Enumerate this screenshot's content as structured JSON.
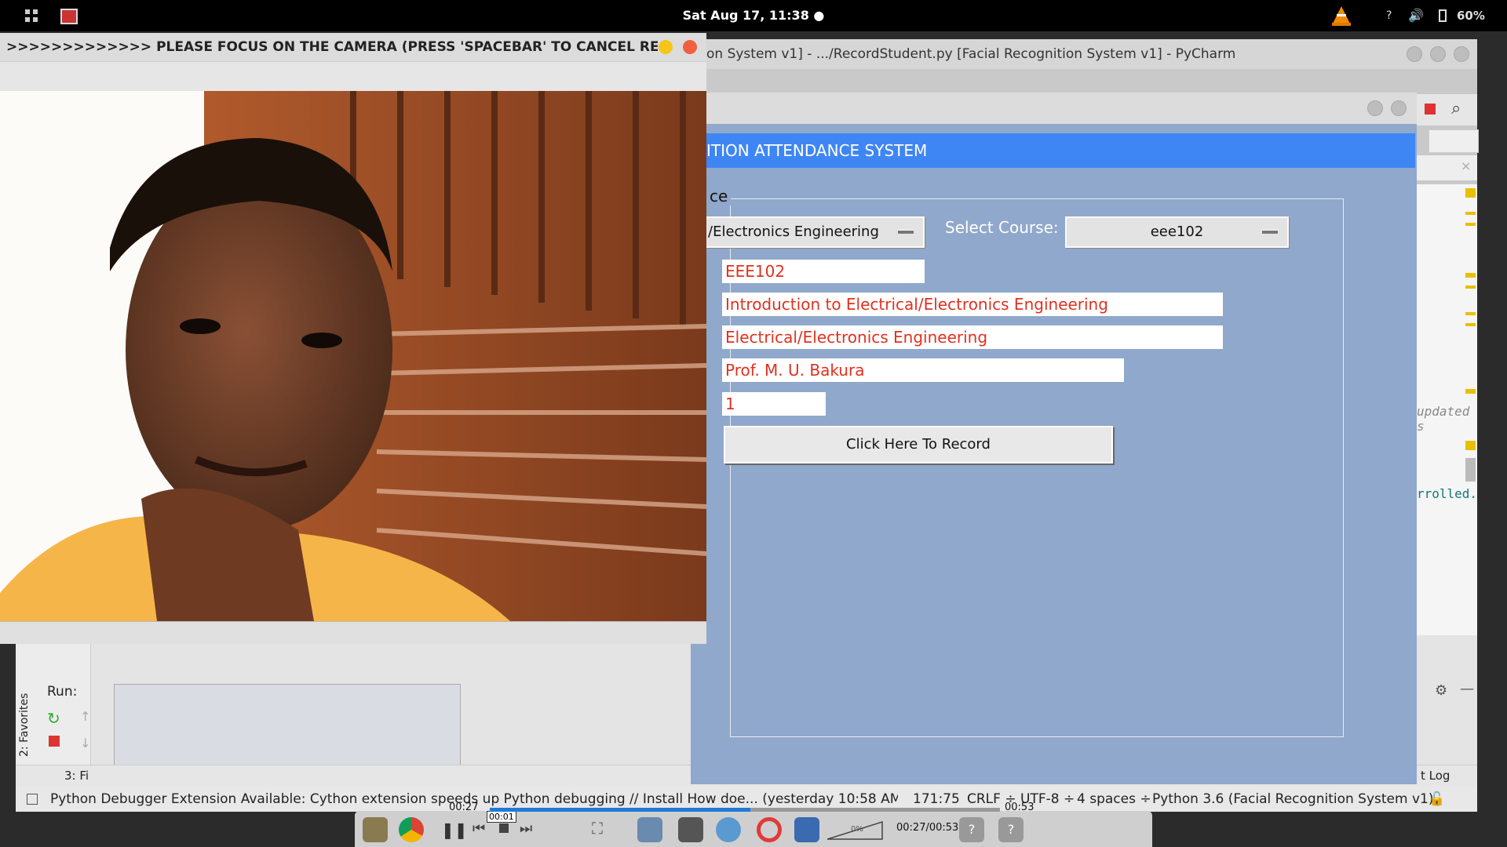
{
  "topbar": {
    "clock": "Sat Aug 17, 11:38 ●",
    "help": "?",
    "battery": "60%"
  },
  "pycharm": {
    "title": "on System v1] - .../RecordStudent.py [Facial Recognition System v1] - PyCharm",
    "code_lines": [
      "updated s",
      "rrolled."
    ],
    "run": {
      "label": "Run:",
      "favorites": "2: Favorites",
      "find": "3: Fi",
      "event_log": "t Log"
    },
    "status": {
      "message": "Python Debugger Extension Available: Cython extension speeds up Python debugging // Install How doe... (yesterday 10:58 AM)",
      "position": "171:75",
      "line_ending": "CRLF ÷",
      "encoding": "UTF-8 ÷",
      "indent": "4 spaces ÷",
      "interpreter": "Python 3.6 (Facial Recognition System v1)"
    }
  },
  "app": {
    "header": "ITION ATTENDANCE SYSTEM",
    "group_label": "ce",
    "department_value": "/Electronics Engineering",
    "select_course_label": "Select Course:",
    "course_value": "eee102",
    "course_code": "EEE102",
    "course_title": "Introduction to Electrical/Electronics Engineering",
    "department": "Electrical/Electronics Engineering",
    "lecturer": "Prof. M. U. Bakura",
    "level": "1",
    "record_button": "Click Here To Record"
  },
  "camera": {
    "title": ">>>>>>>>>>>>> PLEASE FOCUS ON THE CAMERA (PRESS 'SPACEBAR' TO CANCEL RECORDIN..."
  },
  "media": {
    "tooltip": "00:01",
    "elapsed": "00:27",
    "total": "00:53",
    "time_readout": "00:27/00:53",
    "progress": 0.51,
    "volume_label": "0%"
  }
}
